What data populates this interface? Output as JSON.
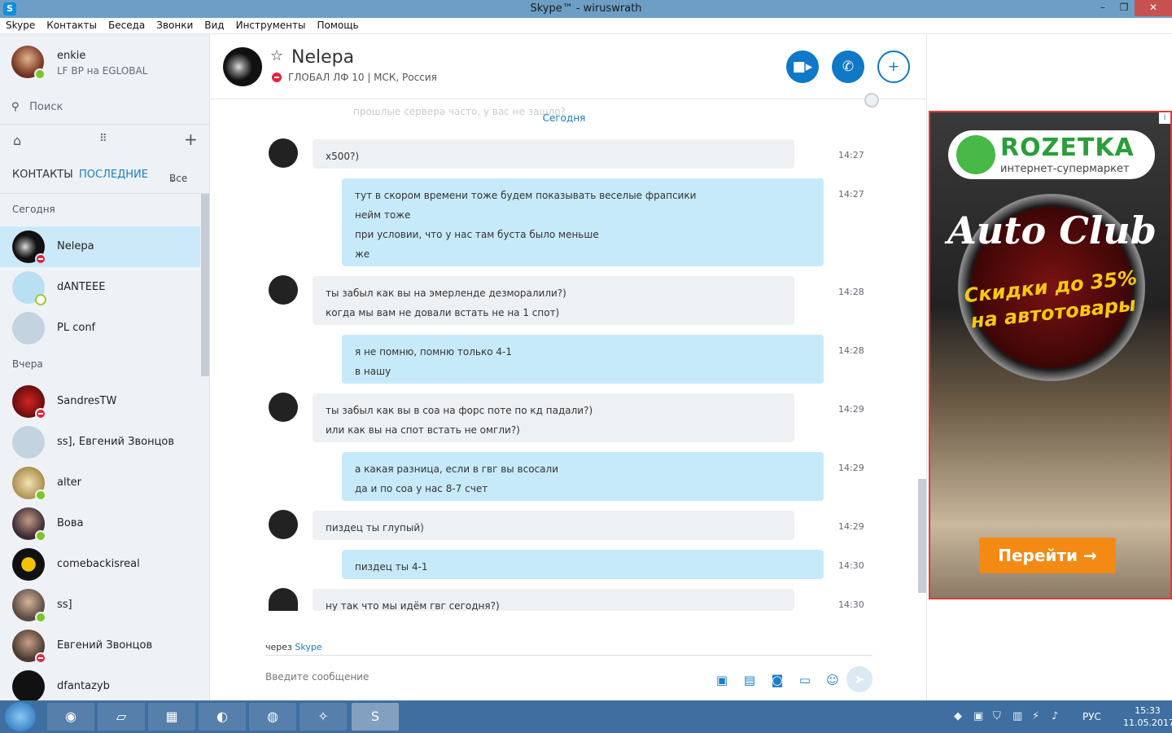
{
  "window": {
    "title": "Skype™ - wiruswrath",
    "app_icon": "S"
  },
  "menu": [
    "Skype",
    "Контакты",
    "Беседа",
    "Звонки",
    "Вид",
    "Инструменты",
    "Помощь"
  ],
  "profile": {
    "name": "enkie",
    "mood": "LF BP на EGLOBAL",
    "status": "online"
  },
  "search": {
    "placeholder": "Поиск"
  },
  "tabs": {
    "contacts": "КОНТАКТЫ",
    "recent": "ПОСЛЕДНИЕ",
    "filter": "Все"
  },
  "sections": {
    "today": "Сегодня",
    "yesterday": "Вчера"
  },
  "contacts_today": [
    {
      "name": "Nelepa",
      "status": "dnd"
    },
    {
      "name": "dANTEEE",
      "status": "away"
    },
    {
      "name": "PL conf",
      "status": ""
    }
  ],
  "contacts_yesterday": [
    {
      "name": "SandresTW",
      "status": "dnd"
    },
    {
      "name": "ss], Евгений Звонцов",
      "status": ""
    },
    {
      "name": "alter",
      "status": "online"
    },
    {
      "name": "Вова",
      "status": "online"
    },
    {
      "name": "comebackisreal",
      "status": ""
    },
    {
      "name": "ss]",
      "status": "online"
    },
    {
      "name": "Евгений Звонцов",
      "status": "dnd"
    },
    {
      "name": "dfantazyb",
      "status": ""
    }
  ],
  "chat": {
    "name": "Nelepa",
    "mood": "ГЛОБАЛ ЛФ 10 | МСК, Россия",
    "faded_line": "прошлые сервера часто, у вас не зашло?",
    "day": "Сегодня",
    "messages": [
      {
        "dir": "in",
        "lines": [
          "x500?)"
        ],
        "time": "14:27"
      },
      {
        "dir": "out",
        "lines": [
          "тут в скором времени тоже будем показывать веселые фрапсики",
          "нейм тоже",
          "при условии, что у нас там буста было меньше",
          "же"
        ],
        "time": "14:27"
      },
      {
        "dir": "in",
        "lines": [
          "ты забыл как вы на эмерленде дезморалили?)",
          "когда мы вам не довали встать не на 1 спот)"
        ],
        "time": "14:28"
      },
      {
        "dir": "out",
        "lines": [
          "я не помню, помню только 4-1",
          "в нашу"
        ],
        "time": "14:28"
      },
      {
        "dir": "in",
        "lines": [
          "ты забыл как вы в соа на форс поте по кд падали?)",
          "или как вы на спот встать не омгли?)"
        ],
        "time": "14:29"
      },
      {
        "dir": "out",
        "lines": [
          "а какая разница, если в гвг вы всосали",
          "да и по соа у нас 8-7 счет"
        ],
        "time": "14:29"
      },
      {
        "dir": "in",
        "lines": [
          "пиздец ты глупый)"
        ],
        "time": "14:29"
      },
      {
        "dir": "out",
        "lines": [
          "пиздец ты 4-1"
        ],
        "time": "14:30"
      },
      {
        "dir": "in",
        "lines": [
          "ну так что мы идём гвг сегодня?)"
        ],
        "time": "14:30"
      }
    ],
    "via_prefix": "через",
    "via_link": "Skype",
    "input_placeholder": "Введите сообщение"
  },
  "ad": {
    "brand": "ROZETKA",
    "brand_sub": "интернет-супермаркет",
    "headline": "Auto Club",
    "promo_line1": "Скидки до 35%",
    "promo_line2": "на автотовары",
    "cta": "Перейти →",
    "info": "i"
  },
  "taskbar": {
    "lang": "РУС",
    "time": "15:33",
    "date": "11.05.2017"
  },
  "colors": {
    "accent": "#0f78c7",
    "bubble_out": "#c7eafb",
    "bubble_in": "#eef1f4",
    "active_contact": "#cce9f9"
  }
}
